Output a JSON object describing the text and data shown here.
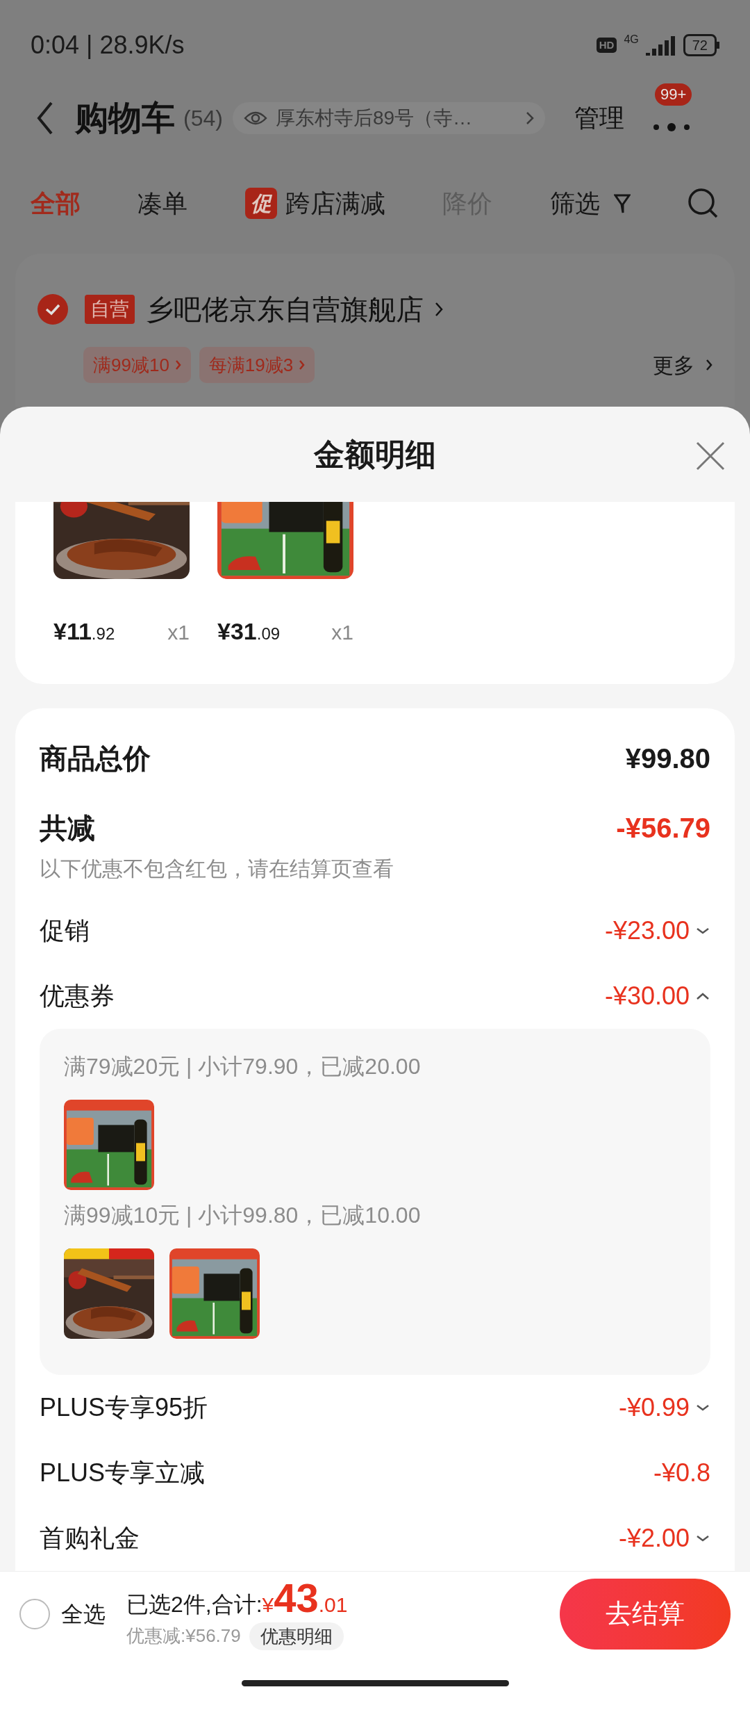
{
  "status_bar": {
    "time": "0:04 | 28.9K/s",
    "hd": "HD",
    "network": "4G",
    "battery": "72"
  },
  "header": {
    "title": "购物车",
    "count": "(54)",
    "address": "厚东村寺后89号（寺…",
    "manage": "管理",
    "badge": "99+"
  },
  "tabs": [
    {
      "label": "全部",
      "selected": true,
      "dimmed": false
    },
    {
      "label": "凑单",
      "selected": false,
      "dimmed": false
    },
    {
      "label": "跨店满减",
      "badge": "促",
      "selected": false,
      "dimmed": false
    },
    {
      "label": "降价",
      "selected": false,
      "dimmed": true
    }
  ],
  "filter": "筛选",
  "store": {
    "checked": true,
    "badge": "自营",
    "name": "乡吧佬京东自营旗舰店",
    "tags": [
      "满99减10",
      "每满19减3"
    ],
    "more": "更多"
  },
  "sheet": {
    "title": "金额明细",
    "products": [
      {
        "kind": "food",
        "price": "¥11",
        "cents": ".92",
        "qty": "x1"
      },
      {
        "kind": "drink",
        "price": "¥31",
        "cents": ".09",
        "qty": "x1"
      }
    ],
    "total": {
      "label": "商品总价",
      "value": "¥99.80"
    },
    "reduction": {
      "label": "共减",
      "value": "-¥56.79",
      "note": "以下优惠不包含红包，请在结算页查看"
    },
    "items": [
      {
        "label": "促销",
        "value": "-¥23.00",
        "expanded": false
      },
      {
        "label": "优惠券",
        "value": "-¥30.00",
        "expanded": true,
        "groups": [
          {
            "text": "满79减20元 | 小计79.90，已减20.00",
            "products": [
              {
                "kind": "drink"
              }
            ]
          },
          {
            "text": "满99减10元 | 小计99.80，已减10.00",
            "products": [
              {
                "kind": "food"
              },
              {
                "kind": "drink"
              }
            ]
          }
        ]
      },
      {
        "label": "PLUS专享95折",
        "value": "-¥0.99",
        "expanded": false
      },
      {
        "label": "PLUS专享立减",
        "value": "-¥0.8"
      },
      {
        "label": "首购礼金",
        "value": "-¥2.00",
        "expanded": false
      }
    ]
  },
  "bottom_bar": {
    "select_all": {
      "label": "全选",
      "checked": false
    },
    "summary": "已选2件,合计:",
    "currency": "¥",
    "amount": "43",
    "cents": ".01",
    "discount": "优惠减:¥56.79",
    "detail_button": "优惠明细",
    "checkout": "去结算"
  }
}
